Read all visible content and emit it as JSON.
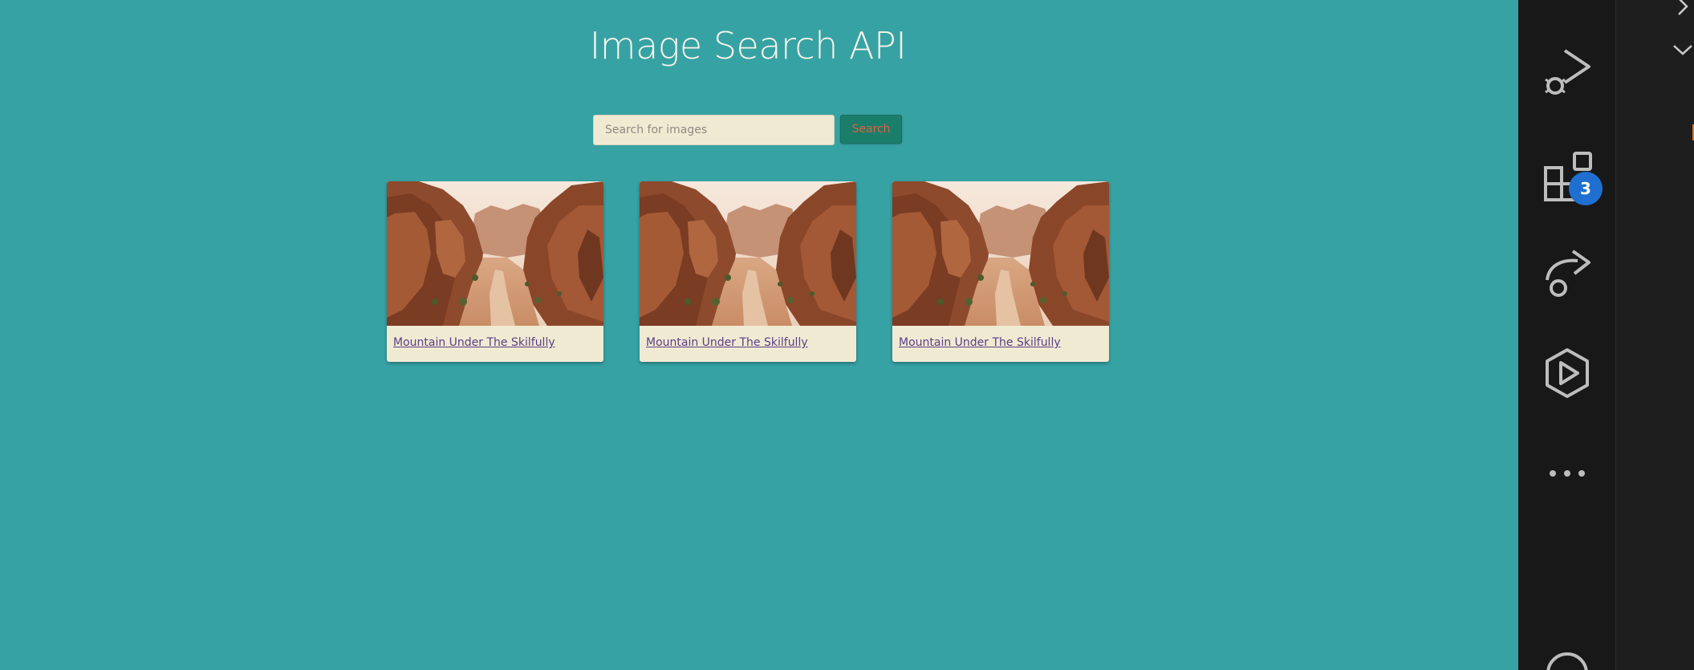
{
  "header": {
    "title": "Image Search API"
  },
  "search": {
    "placeholder": "Search for images",
    "value": "",
    "button_label": "Search"
  },
  "results": [
    {
      "title": "Mountain Under The Skilfully",
      "image": "canyon-photo"
    },
    {
      "title": "Mountain Under The Skilfully",
      "image": "canyon-photo"
    },
    {
      "title": "Mountain Under The Skilfully",
      "image": "canyon-photo"
    }
  ],
  "activity_bar": {
    "items": [
      {
        "icon": "run-debug-icon"
      },
      {
        "icon": "extensions-icon",
        "badge": "3"
      },
      {
        "icon": "remote-explorer-icon"
      },
      {
        "icon": "deploy-icon"
      },
      {
        "icon": "more-icon"
      }
    ]
  },
  "colors": {
    "background": "#37a2a4",
    "title": "#f7f4ea",
    "input_bg": "#f1ead3",
    "button_bg": "#1a7e6b",
    "button_text": "#e2603d",
    "link": "#5a3f86",
    "activity_bar": "#181818",
    "badge": "#1f6fd0"
  }
}
